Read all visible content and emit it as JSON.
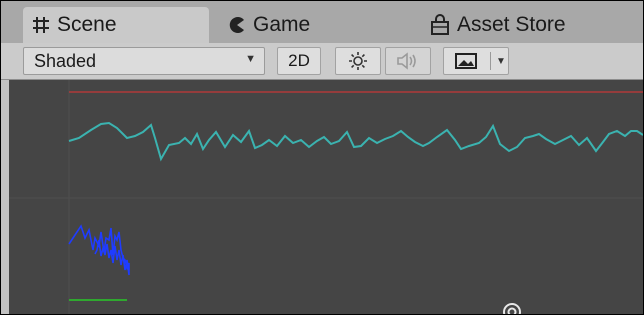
{
  "tabs": [
    {
      "label": "Scene",
      "icon": "hash-icon",
      "active": true
    },
    {
      "label": "Game",
      "icon": "pacman-icon",
      "active": false
    },
    {
      "label": "Asset Store",
      "icon": "shopping-bag-icon",
      "active": false
    }
  ],
  "toolbar": {
    "shading_mode": "Shaded",
    "mode_2d_label": "2D",
    "lighting_icon": "sun-icon",
    "audio_icon": "speaker-icon",
    "effects_icon": "image-icon",
    "effects_dropdown_icon": "caret-down-icon"
  },
  "viewport": {
    "colors": {
      "background": "#454545",
      "grid": "#4f4f4f",
      "red_line": "#b03a3a",
      "teal_line": "#3bb3b0",
      "blue_line": "#1f3cff",
      "green_line": "#2fa82f"
    },
    "gizmo_icon": "target-icon"
  }
}
